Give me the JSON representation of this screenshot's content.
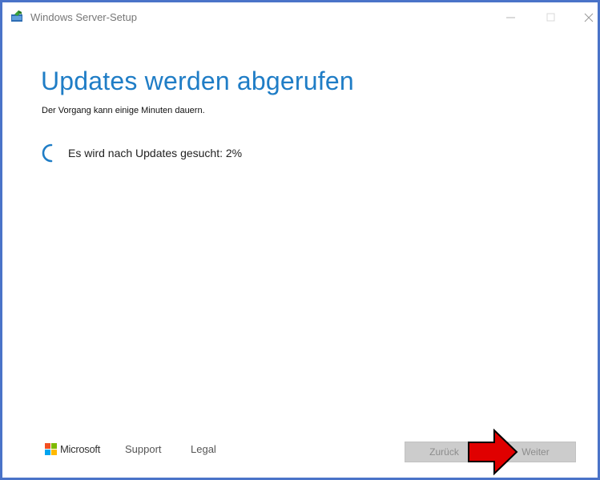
{
  "window": {
    "title": "Windows Server-Setup",
    "controls": {
      "minimize": "—",
      "maximize": "☐",
      "close": "✕"
    }
  },
  "main": {
    "title": "Updates werden abgerufen",
    "subtitle": "Der Vorgang kann einige Minuten dauern.",
    "status": "Es wird nach Updates gesucht: 2%",
    "progress_percent": 2
  },
  "footer": {
    "brand": "Microsoft",
    "links": [
      "Support",
      "Legal"
    ],
    "back_label": "Zurück",
    "next_label": "Weiter"
  },
  "colors": {
    "window_border": "#4a73c8",
    "title_accent": "#1f7dc6",
    "annotation_arrow": "#e00000"
  },
  "icons": {
    "app": "setup-icon",
    "spinner": "loading-spinner-icon",
    "annotation": "red-arrow-icon"
  }
}
